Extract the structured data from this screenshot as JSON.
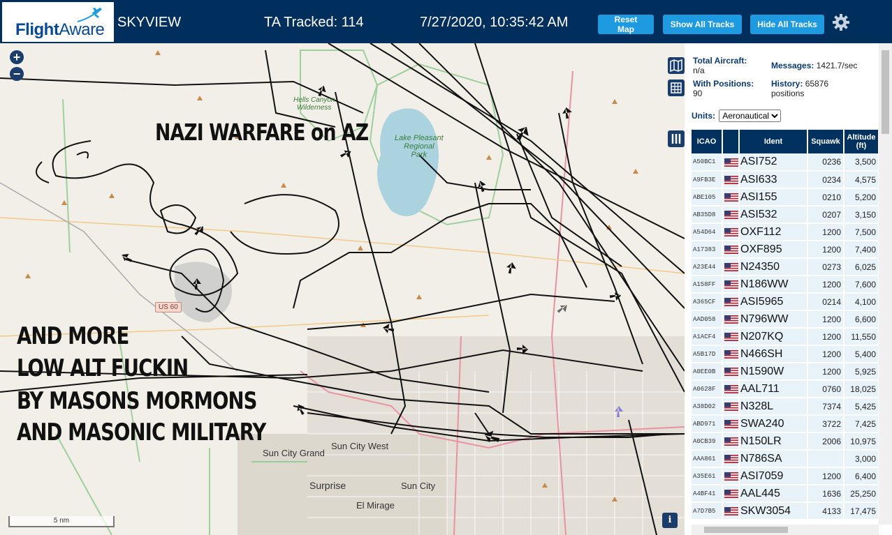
{
  "header": {
    "logo_main": "Flight",
    "logo_suffix": "Aware",
    "app_name": "SKYVIEW",
    "ta_tracked": "TA Tracked: 114",
    "datetime": "7/27/2020, 10:35:42 AM",
    "buttons": {
      "reset": "Reset Map",
      "show_all": "Show All Tracks",
      "hide_all": "Hide All Tracks"
    },
    "icons": {
      "settings": "gear-icon",
      "logo": "plane-icon"
    }
  },
  "map": {
    "zoom_in": "+",
    "zoom_out": "−",
    "scale": "5 nm",
    "info": "i",
    "overlay_title": "NAZI WARFARE on AZ",
    "overlay_lines": [
      "AND MORE",
      "LOW ALT FUCKIN",
      "BY MASONS MORMONS",
      "AND MASONIC MILITARY"
    ],
    "labels": {
      "hells_canyon": "Hells Canyon",
      "wilderness": "Wilderness",
      "lake_pleasant": "Lake Pleasant",
      "regional": "Regional",
      "park": "Park",
      "sun_city_west": "Sun City West",
      "sun_city_grand": "Sun City Grand",
      "surprise": "Surprise",
      "sun_city": "Sun City",
      "el_mirage": "El Mirage",
      "us60": "US 60"
    },
    "colors": {
      "track": "#111111",
      "water": "#aad3df",
      "green_boundary": "#8fc98f",
      "urban": "#ded9d0",
      "road": "#e892a2"
    }
  },
  "sidebar": {
    "stats": {
      "total_aircraft_label": "Total Aircraft:",
      "total_aircraft_value": "n/a",
      "messages_label": "Messages:",
      "messages_value": "1421.7/sec",
      "with_positions_label": "With Positions:",
      "with_positions_value": "90",
      "history_label": "History:",
      "history_value": "65876",
      "history_unit": "positions"
    },
    "units_label": "Units:",
    "units_selected": "Aeronautical",
    "columns": {
      "icao": "ICAO",
      "ident": "Ident",
      "squawk": "Squawk",
      "altitude": "Altitude",
      "altitude_unit": "(ft)"
    },
    "rows": [
      {
        "icao": "A50BC1",
        "ident": "ASI752",
        "squawk": "0236",
        "alt": "3,500"
      },
      {
        "icao": "A9FB3E",
        "ident": "ASI633",
        "squawk": "0234",
        "alt": "4,575"
      },
      {
        "icao": "ABE105",
        "ident": "ASI155",
        "squawk": "0210",
        "alt": "5,200"
      },
      {
        "icao": "AB35D8",
        "ident": "ASI532",
        "squawk": "0207",
        "alt": "3,150"
      },
      {
        "icao": "A54D64",
        "ident": "OXF112",
        "squawk": "1200",
        "alt": "7,500"
      },
      {
        "icao": "A17383",
        "ident": "OXF895",
        "squawk": "1200",
        "alt": "7,400"
      },
      {
        "icao": "A23E44",
        "ident": "N24350",
        "squawk": "0273",
        "alt": "6,025"
      },
      {
        "icao": "A158FF",
        "ident": "N186WW",
        "squawk": "1200",
        "alt": "7,600"
      },
      {
        "icao": "A365CF",
        "ident": "ASI5965",
        "squawk": "0214",
        "alt": "4,100"
      },
      {
        "icao": "AAD058",
        "ident": "N796WW",
        "squawk": "1200",
        "alt": "6,600"
      },
      {
        "icao": "A1ACF4",
        "ident": "N207KQ",
        "squawk": "1200",
        "alt": "11,550"
      },
      {
        "icao": "A5B17D",
        "ident": "N466SH",
        "squawk": "1200",
        "alt": "5,400"
      },
      {
        "icao": "A0EE0B",
        "ident": "N1590W",
        "squawk": "1200",
        "alt": "5,925"
      },
      {
        "icao": "A0628F",
        "ident": "AAL711",
        "squawk": "0760",
        "alt": "18,025"
      },
      {
        "icao": "A38D02",
        "ident": "N328L",
        "squawk": "7374",
        "alt": "5,425"
      },
      {
        "icao": "ABD971",
        "ident": "SWA240",
        "squawk": "3722",
        "alt": "7,425"
      },
      {
        "icao": "A0CB39",
        "ident": "N150LR",
        "squawk": "2006",
        "alt": "10,975"
      },
      {
        "icao": "AAA861",
        "ident": "N786SA",
        "squawk": "",
        "alt": "3,000"
      },
      {
        "icao": "A35E61",
        "ident": "ASI7059",
        "squawk": "1200",
        "alt": "6,400"
      },
      {
        "icao": "A4BF41",
        "ident": "AAL445",
        "squawk": "1636",
        "alt": "25,250"
      },
      {
        "icao": "A7D7B5",
        "ident": "SKW3054",
        "squawk": "4133",
        "alt": "17,475"
      }
    ]
  }
}
